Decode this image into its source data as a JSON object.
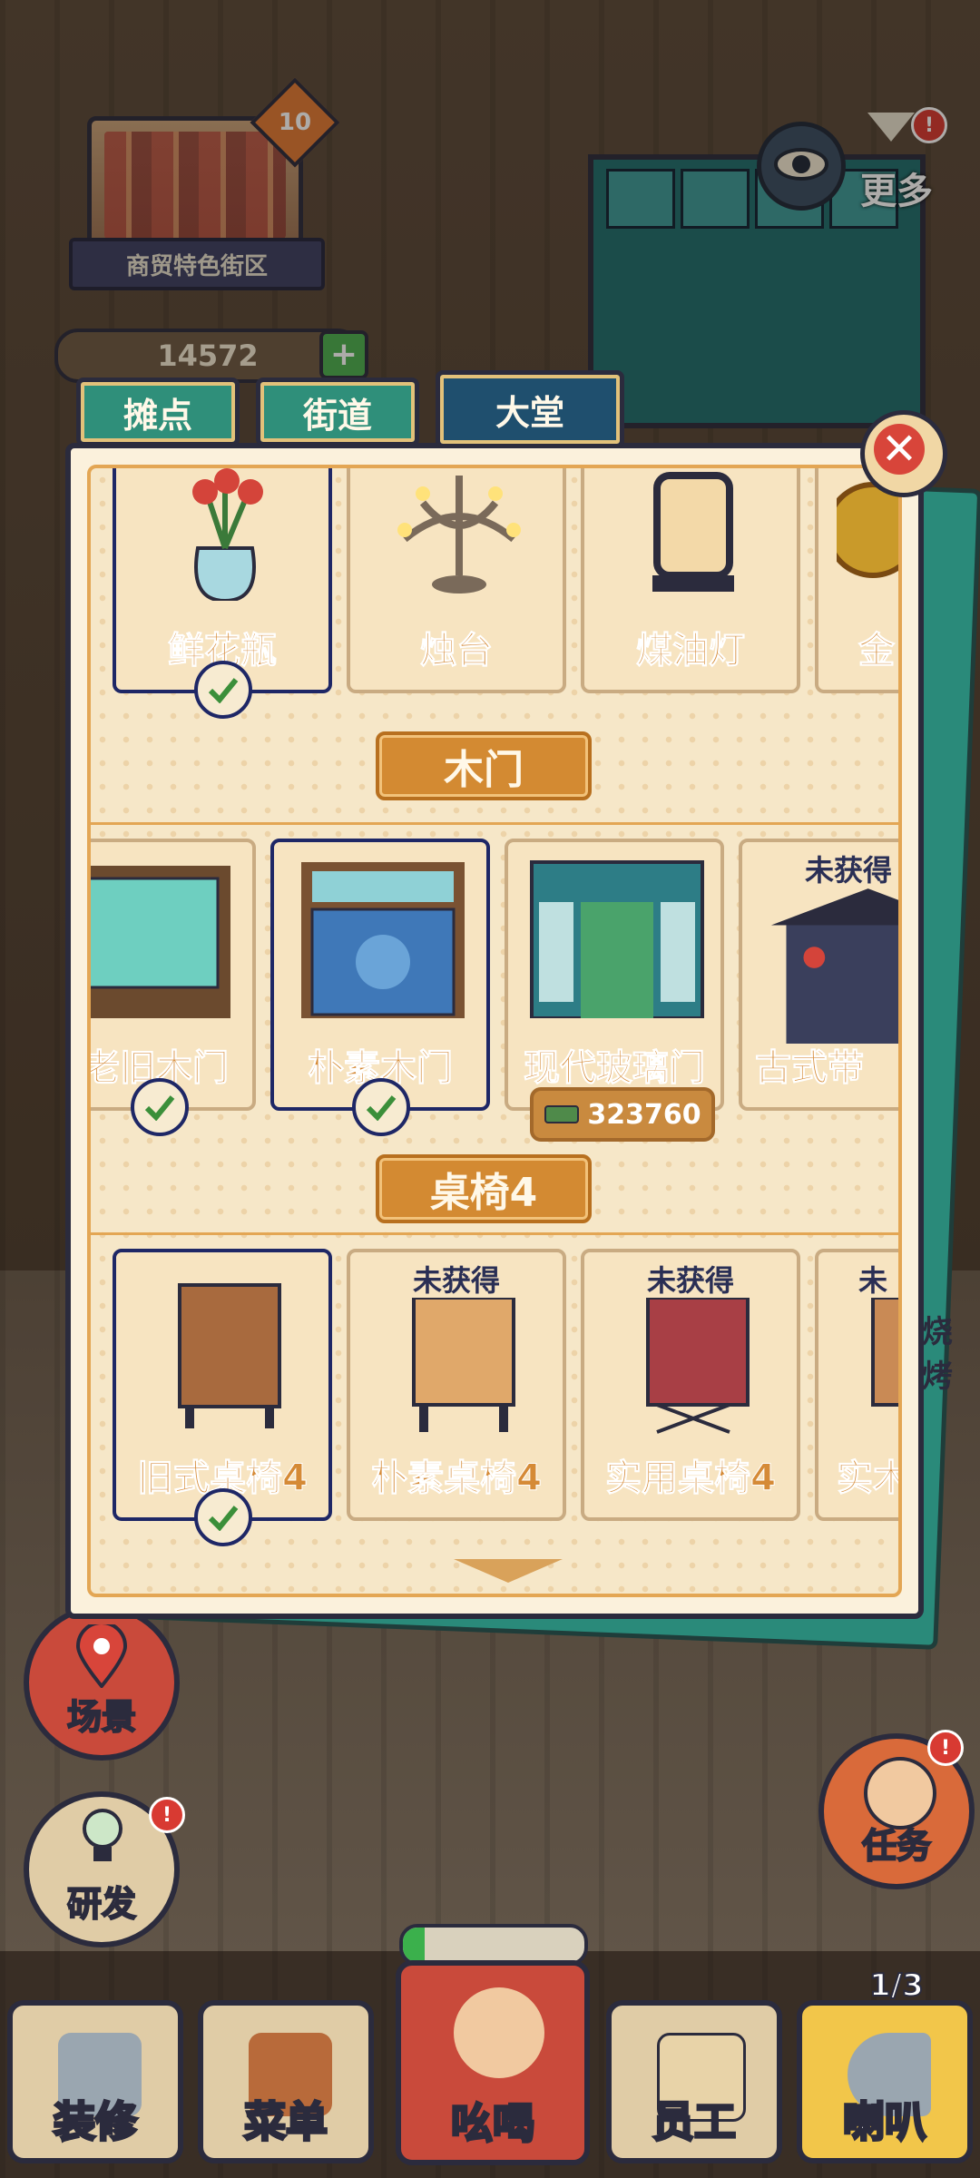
{
  "hud": {
    "district_name": "商贸特色街区",
    "district_level": "10",
    "money": "14572",
    "money_plus": "+",
    "more_label": "更多",
    "more_alert": "!"
  },
  "tabs": [
    {
      "label": "摊点",
      "active": false
    },
    {
      "label": "街道",
      "active": false
    },
    {
      "label": "大堂",
      "active": true
    }
  ],
  "close_label": "✕",
  "sections": {
    "decor": {
      "items": [
        {
          "name": "鲜花瓶",
          "icon": "flower-vase-icon",
          "selected": true,
          "owned": true
        },
        {
          "name": "烛台",
          "icon": "candelabra-icon",
          "selected": false,
          "owned": false
        },
        {
          "name": "煤油灯",
          "icon": "oil-lamp-icon",
          "selected": false,
          "owned": false
        },
        {
          "name": "金",
          "icon": "gold-ornament-icon",
          "selected": false,
          "owned": false
        }
      ]
    },
    "door": {
      "title": "木门",
      "items": [
        {
          "name": "老旧木门",
          "selected": false,
          "owned": true
        },
        {
          "name": "朴素木门",
          "selected": true,
          "owned": true
        },
        {
          "name": "现代玻璃门",
          "selected": false,
          "owned": false,
          "price": "323760"
        },
        {
          "name": "古式带",
          "selected": false,
          "owned": false,
          "locked_label": "未获得"
        }
      ]
    },
    "table": {
      "title": "桌椅4",
      "items": [
        {
          "name": "旧式桌椅4",
          "selected": true,
          "owned": true
        },
        {
          "name": "朴素桌椅4",
          "selected": false,
          "owned": false,
          "locked_label": "未获得"
        },
        {
          "name": "实用桌椅4",
          "selected": false,
          "owned": false,
          "locked_label": "未获得"
        },
        {
          "name": "实木",
          "selected": false,
          "owned": false,
          "locked_label": "未"
        }
      ]
    }
  },
  "side": {
    "scene_label": "场景",
    "research_label": "研发",
    "research_alert": "!",
    "task_label": "任务",
    "task_alert": "!",
    "right_sign": "烧烤"
  },
  "bottom_nav": [
    {
      "label": "装修"
    },
    {
      "label": "菜单"
    },
    {
      "label": "吆喝"
    },
    {
      "label": "员工"
    },
    {
      "label": "喇叭"
    }
  ],
  "horn_count": "1/3",
  "progress": 0.12,
  "colors": {
    "accent_orange": "#d38a32",
    "tab_active": "#1f4f6e",
    "tab_inactive": "#2f8f7a",
    "close_red": "#d8453a"
  }
}
